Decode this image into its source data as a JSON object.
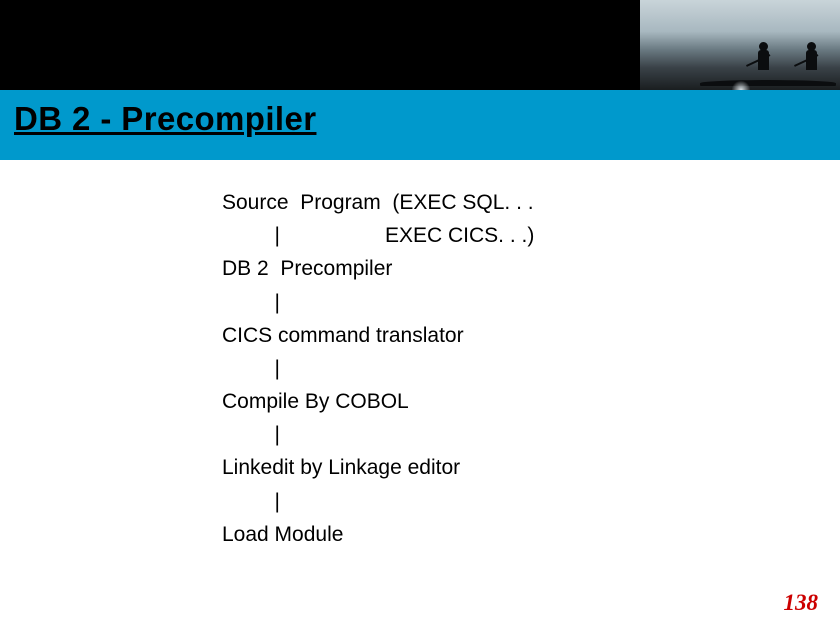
{
  "slide": {
    "title": "DB 2 - Precompiler",
    "lines": [
      "Source  Program  (EXEC SQL. . .",
      "         |                  EXEC CICS. . .)",
      "DB 2  Precompiler",
      "         |",
      "CICS command translator",
      "         |",
      "Compile By COBOL",
      "         |",
      "Linkedit by Linkage editor",
      "         |",
      "Load Module"
    ],
    "page_number": "138"
  }
}
